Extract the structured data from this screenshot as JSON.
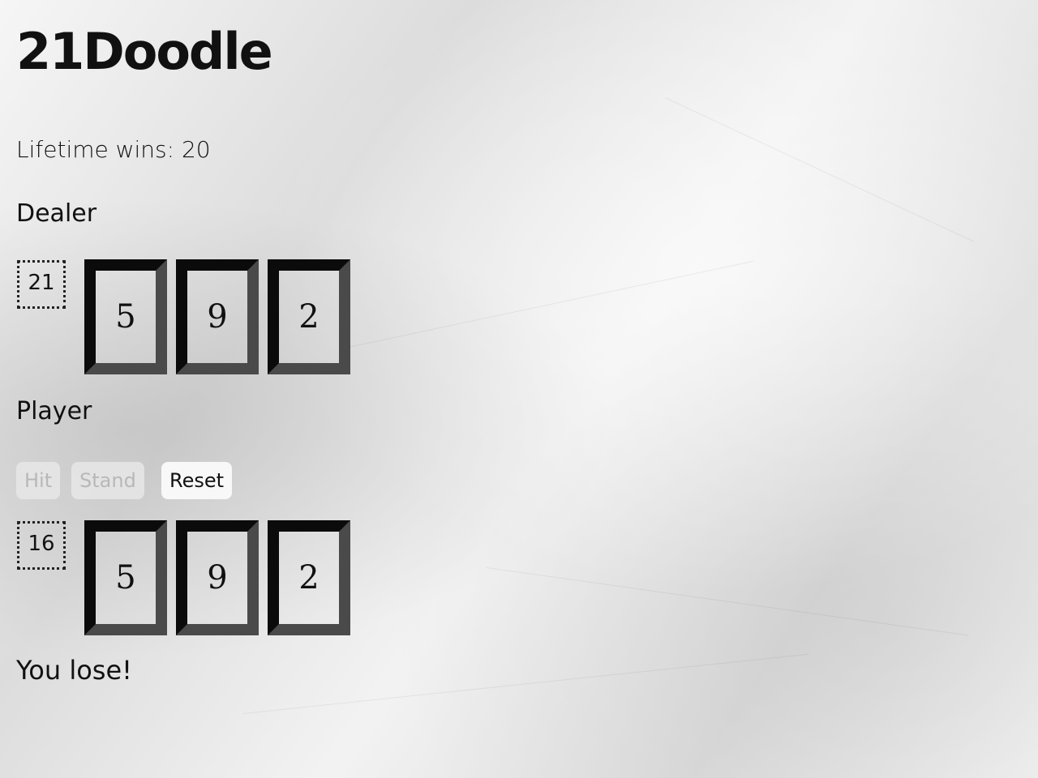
{
  "app": {
    "title": "21Doodle"
  },
  "stats": {
    "lifetime_wins_text": "Lifetime wins: 20"
  },
  "dealer": {
    "label": "Dealer",
    "score": "21",
    "cards": [
      "5",
      "9",
      "2"
    ]
  },
  "player": {
    "label": "Player",
    "score": "16",
    "cards": [
      "5",
      "9",
      "2"
    ]
  },
  "controls": {
    "hit_label": "Hit",
    "stand_label": "Stand",
    "reset_label": "Reset"
  },
  "result": {
    "message": "You lose!"
  },
  "colors": {
    "card_dark_border": "#0b0b0b",
    "card_shadow_border": "#4a4a4a",
    "disabled_text": "#b8b8b8"
  }
}
